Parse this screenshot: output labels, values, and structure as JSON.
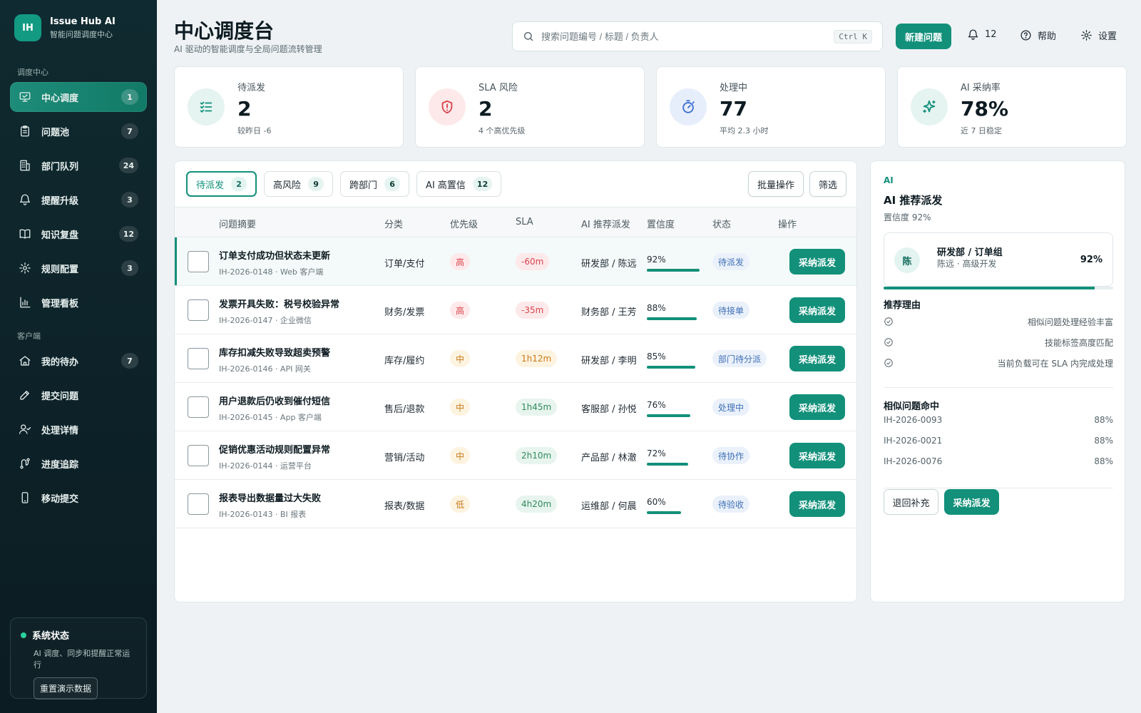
{
  "brand": {
    "logo": "IH",
    "name": "Issue Hub AI",
    "subtitle": "智能问题调度中心"
  },
  "sidebar": {
    "section1": "调度中心",
    "section2": "客户端",
    "items1": [
      {
        "label": "中心调度",
        "count": "1",
        "icon": "monitor-icon",
        "active": true
      },
      {
        "label": "问题池",
        "count": "7",
        "icon": "clipboard-icon"
      },
      {
        "label": "部门队列",
        "count": "24",
        "icon": "building-icon"
      },
      {
        "label": "提醒升级",
        "count": "3",
        "icon": "bell-icon"
      },
      {
        "label": "知识复盘",
        "count": "12",
        "icon": "book-icon"
      },
      {
        "label": "规则配置",
        "count": "3",
        "icon": "gear-icon"
      },
      {
        "label": "管理看板",
        "count": "",
        "icon": "bar-chart-icon"
      }
    ],
    "items2": [
      {
        "label": "我的待办",
        "count": "7",
        "icon": "home-icon"
      },
      {
        "label": "提交问题",
        "count": "",
        "icon": "pen-icon"
      },
      {
        "label": "处理详情",
        "count": "",
        "icon": "user-check-icon"
      },
      {
        "label": "进度追踪",
        "count": "",
        "icon": "route-icon"
      },
      {
        "label": "移动提交",
        "count": "",
        "icon": "phone-icon"
      }
    ],
    "status": {
      "title": "系统状态",
      "desc": "AI 调度、同步和提醒正常运行",
      "button": "重置演示数据",
      "color": "#2bd19b"
    }
  },
  "header": {
    "title": "中心调度台",
    "subtitle": "AI 驱动的智能调度与全局问题流转管理",
    "search_placeholder": "搜索问题编号 / 标题 / 负责人",
    "shortcut": "Ctrl K",
    "new_button": "新建问题",
    "notifications": "12",
    "help": "帮助",
    "settings": "设置"
  },
  "stats": [
    {
      "label": "待派发",
      "value": "2",
      "note": "较昨日 -6",
      "icon": "list-check-icon",
      "color": "#12907a",
      "bg": "#e5f4f1"
    },
    {
      "label": "SLA 风险",
      "value": "2",
      "note": "4 个高优先级",
      "icon": "shield-alert-icon",
      "color": "#d9434b",
      "bg": "#fde9ea"
    },
    {
      "label": "处理中",
      "value": "77",
      "note": "平均 2.3 小时",
      "icon": "timer-icon",
      "color": "#3b6fd4",
      "bg": "#e7eefb"
    },
    {
      "label": "AI 采纳率",
      "value": "78%",
      "note": "近 7 日稳定",
      "icon": "sparkle-icon",
      "color": "#12907a",
      "bg": "#e5f4f1"
    }
  ],
  "filters": [
    {
      "label": "待派发",
      "count": "2",
      "active": true
    },
    {
      "label": "高风险",
      "count": "9"
    },
    {
      "label": "跨部门",
      "count": "6"
    },
    {
      "label": "AI 高置信",
      "count": "12"
    }
  ],
  "tools": {
    "batch": "批量操作",
    "filter": "筛选"
  },
  "table": {
    "headers": [
      "问题摘要",
      "分类",
      "优先级",
      "SLA",
      "AI 推荐派发",
      "置信度",
      "状态",
      "操作"
    ],
    "action_label": "采纳派发",
    "rows": [
      {
        "title": "订单支付成功但状态未更新",
        "id": "IH-2026-0148 · Web 客户端",
        "category": "订单/支付",
        "priority": "高",
        "priority_level": "high",
        "sla": "-60m",
        "sla_level": "over",
        "assignee": "研发部 / 陈远",
        "confidence": 92,
        "confidence_label": "92%",
        "status": "待派发"
      },
      {
        "title": "发票开具失败：税号校验异常",
        "id": "IH-2026-0147 · 企业微信",
        "category": "财务/发票",
        "priority": "高",
        "priority_level": "high",
        "sla": "-35m",
        "sla_level": "over",
        "assignee": "财务部 / 王芳",
        "confidence": 88,
        "confidence_label": "88%",
        "status": "待接单"
      },
      {
        "title": "库存扣减失败导致超卖预警",
        "id": "IH-2026-0146 · API 网关",
        "category": "库存/履约",
        "priority": "中",
        "priority_level": "mid",
        "sla": "1h12m",
        "sla_level": "warn",
        "assignee": "研发部 / 李明",
        "confidence": 85,
        "confidence_label": "85%",
        "status": "部门待分派"
      },
      {
        "title": "用户退款后仍收到催付短信",
        "id": "IH-2026-0145 · App 客户端",
        "category": "售后/退款",
        "priority": "中",
        "priority_level": "mid",
        "sla": "1h45m",
        "sla_level": "ok",
        "assignee": "客服部 / 孙悦",
        "confidence": 76,
        "confidence_label": "76%",
        "status": "处理中"
      },
      {
        "title": "促销优惠活动规则配置异常",
        "id": "IH-2026-0144 · 运营平台",
        "category": "营销/活动",
        "priority": "中",
        "priority_level": "mid",
        "sla": "2h10m",
        "sla_level": "ok",
        "assignee": "产品部 / 林澈",
        "confidence": 72,
        "confidence_label": "72%",
        "status": "待协作"
      },
      {
        "title": "报表导出数据量过大失败",
        "id": "IH-2026-0143 · BI 报表",
        "category": "报表/数据",
        "priority": "低",
        "priority_level": "low",
        "sla": "4h20m",
        "sla_level": "ok",
        "assignee": "运维部 / 何晨",
        "confidence": 60,
        "confidence_label": "60%",
        "status": "待验收"
      }
    ]
  },
  "panel": {
    "tag": "AI",
    "title": "AI 推荐派发",
    "confidence": "置信度 92%",
    "rec_avatar": "陈",
    "rec_team": "研发部 / 订单组",
    "rec_person": "陈远 · 高级开发",
    "rec_score": "92%",
    "rec_fill": 0.92,
    "reasons_title": "推荐理由",
    "reasons": [
      "相似问题处理经验丰富",
      "技能标签高度匹配",
      "当前负载可在 SLA 内完成处理"
    ],
    "similar_title": "相似问题命中",
    "similar": [
      {
        "id": "IH-2026-0093",
        "pct": "88%"
      },
      {
        "id": "IH-2026-0021",
        "pct": "88%"
      },
      {
        "id": "IH-2026-0076",
        "pct": "88%"
      }
    ],
    "return_button": "退回补充",
    "adopt_button": "采纳派发"
  }
}
